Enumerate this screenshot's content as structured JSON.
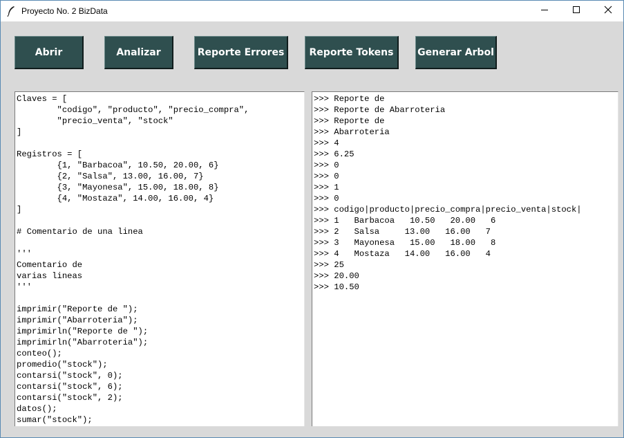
{
  "window": {
    "title": "Proyecto No. 2 BizData",
    "icons": {
      "app": "feather-icon",
      "minimize": "minimize-icon",
      "maximize": "maximize-icon",
      "close": "close-icon"
    }
  },
  "toolbar": {
    "abrir": "Abrir",
    "analizar": "Analizar",
    "reporte_errores": "Reporte Errores",
    "reporte_tokens": "Reporte Tokens",
    "generar_arbol": "Generar Arbol"
  },
  "colors": {
    "button_bg": "#2f4f4f",
    "button_text": "#ffffff",
    "window_bg": "#d9d9d9"
  },
  "editor": {
    "lines": [
      "Claves = [",
      "        \"codigo\", \"producto\", \"precio_compra\",",
      "        \"precio_venta\", \"stock\"",
      "]",
      "",
      "Registros = [",
      "        {1, \"Barbacoa\", 10.50, 20.00, 6}",
      "        {2, \"Salsa\", 13.00, 16.00, 7}",
      "        {3, \"Mayonesa\", 15.00, 18.00, 8}",
      "        {4, \"Mostaza\", 14.00, 16.00, 4}",
      "]",
      "",
      "# Comentario de una linea",
      "",
      "'''",
      "Comentario de",
      "varias lineas",
      "'''",
      "",
      "imprimir(\"Reporte de \");",
      "imprimir(\"Abarroteria\");",
      "imprimirln(\"Reporte de \");",
      "imprimirln(\"Abarroteria\");",
      "conteo();",
      "promedio(\"stock\");",
      "contarsi(\"stock\", 0);",
      "contarsi(\"stock\", 6);",
      "contarsi(\"stock\", 2);",
      "datos();",
      "sumar(\"stock\");"
    ]
  },
  "console": {
    "lines": [
      ">>> Reporte de",
      ">>> Reporte de Abarroteria",
      ">>> Reporte de",
      ">>> Abarroteria",
      ">>> 4",
      ">>> 6.25",
      ">>> 0",
      ">>> 0",
      ">>> 1",
      ">>> 0",
      ">>> codigo|producto|precio_compra|precio_venta|stock|",
      ">>> 1   Barbacoa   10.50   20.00   6",
      ">>> 2   Salsa     13.00   16.00   7",
      ">>> 3   Mayonesa   15.00   18.00   8",
      ">>> 4   Mostaza   14.00   16.00   4",
      ">>> 25",
      ">>> 20.00",
      ">>> 10.50"
    ]
  }
}
